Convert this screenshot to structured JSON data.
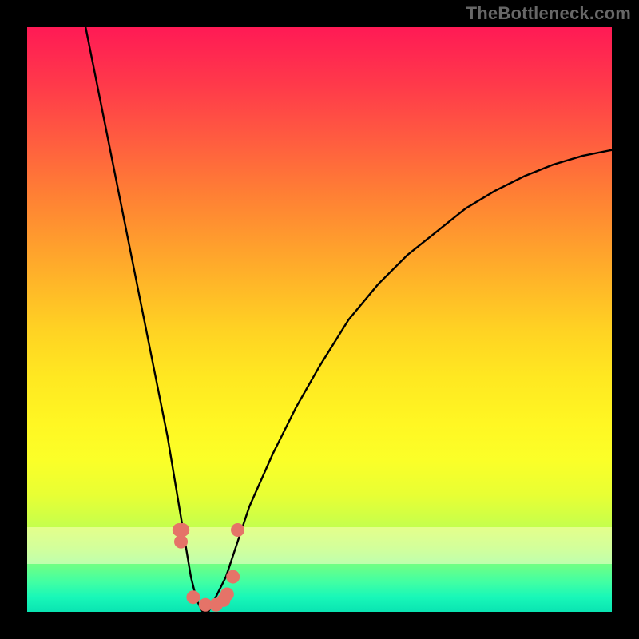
{
  "watermark": "TheBottleneck.com",
  "chart_data": {
    "type": "line",
    "title": "",
    "xlabel": "",
    "ylabel": "",
    "xlim": [
      0,
      100
    ],
    "ylim": [
      0,
      100
    ],
    "grid": false,
    "legend": false,
    "series": [
      {
        "name": "main-curve",
        "stroke": "#000000",
        "x": [
          10,
          12,
          15,
          18,
          20,
          22,
          24,
          26,
          27,
          28,
          29,
          30,
          31,
          32,
          34,
          36,
          38,
          42,
          46,
          50,
          55,
          60,
          65,
          70,
          75,
          80,
          85,
          90,
          95,
          100
        ],
        "y": [
          100,
          90,
          75,
          60,
          50,
          40,
          30,
          18,
          12,
          6,
          2,
          0,
          0,
          2,
          6,
          12,
          18,
          27,
          35,
          42,
          50,
          56,
          61,
          65,
          69,
          72,
          74.5,
          76.5,
          78,
          79
        ]
      }
    ],
    "markers": {
      "name": "highlight-dots",
      "color": "#e57368",
      "points": [
        {
          "x": 26.0,
          "y": 14
        },
        {
          "x": 26.3,
          "y": 12
        },
        {
          "x": 26.6,
          "y": 14
        },
        {
          "x": 28.4,
          "y": 2.5
        },
        {
          "x": 30.5,
          "y": 1.2
        },
        {
          "x": 32.3,
          "y": 1.2
        },
        {
          "x": 33.6,
          "y": 2.0
        },
        {
          "x": 34.2,
          "y": 3.0
        },
        {
          "x": 35.2,
          "y": 6.0
        },
        {
          "x": 36.0,
          "y": 14
        }
      ]
    },
    "gradient_colormap": {
      "0": "#ff1a55",
      "50": "#fff723",
      "100": "#0ae4b2"
    }
  }
}
